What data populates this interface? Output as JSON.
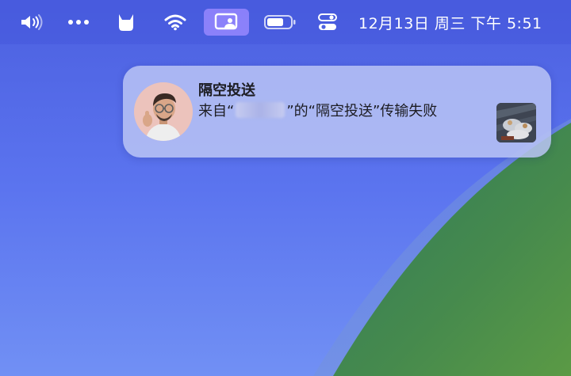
{
  "menubar": {
    "icons": [
      {
        "name": "volume-icon"
      },
      {
        "name": "more-icon"
      },
      {
        "name": "cat-app-icon"
      },
      {
        "name": "wifi-icon"
      },
      {
        "name": "screen-mirroring-icon",
        "active": true
      },
      {
        "name": "battery-icon"
      },
      {
        "name": "control-center-icon"
      }
    ],
    "clock": "12月13日 周三  下午 5:51"
  },
  "notification": {
    "title": "隔空投送",
    "body_prefix": "来自“",
    "body_suffix": "”的“隔空投送”传输失败",
    "avatar_icon": "memoji-avatar",
    "thumbnail_icon": "photo-thumbnail"
  },
  "colors": {
    "wallpaper_blue": "#5a73ee",
    "wallpaper_green": "#3f8b57",
    "active_menu": "#9687ff",
    "notification_bg": "#bac4f5"
  }
}
